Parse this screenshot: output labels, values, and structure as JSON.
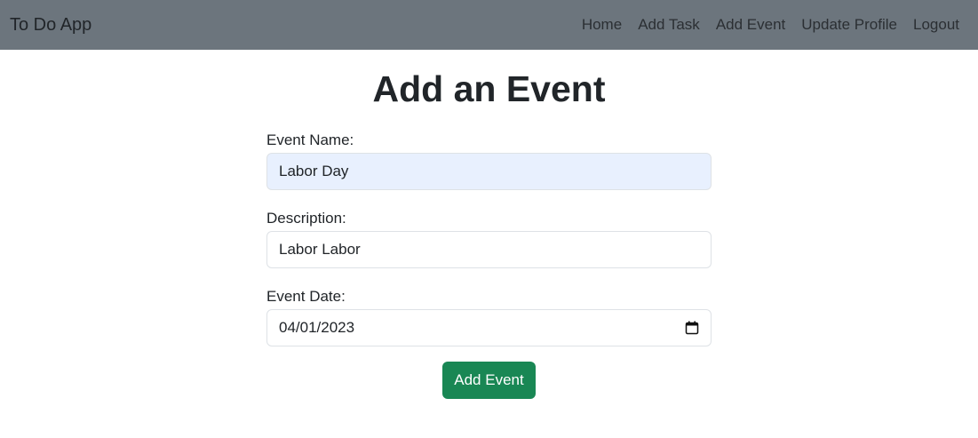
{
  "navbar": {
    "brand": "To Do App",
    "links": [
      "Home",
      "Add Task",
      "Add Event",
      "Update Profile",
      "Logout"
    ]
  },
  "page": {
    "title": "Add an Event"
  },
  "form": {
    "event_name": {
      "label": "Event Name:",
      "value": "Labor Day"
    },
    "description": {
      "label": "Description:",
      "value": "Labor Labor"
    },
    "event_date": {
      "label": "Event Date:",
      "value": "04/01/2023",
      "icon": "calendar-icon"
    },
    "submit_label": "Add Event"
  },
  "colors": {
    "navbar_bg": "#6c757d",
    "autofill_bg": "#e8f0fe",
    "button_bg": "#198754"
  }
}
